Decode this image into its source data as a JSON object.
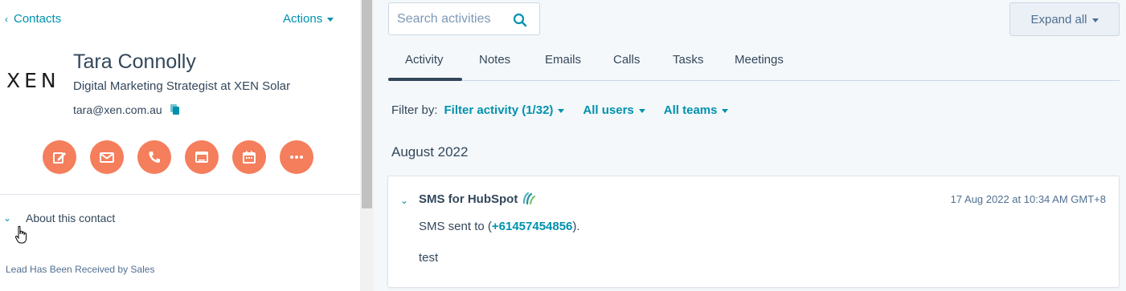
{
  "left_panel": {
    "back_label": "Contacts",
    "actions_label": "Actions",
    "logo_text": "XEN",
    "contact_name": "Tara Connolly",
    "contact_title": "Digital Marketing Strategist at XEN Solar",
    "contact_email": "tara@xen.com.au",
    "action_buttons": [
      {
        "icon": "note-icon"
      },
      {
        "icon": "email-icon"
      },
      {
        "icon": "phone-icon"
      },
      {
        "icon": "task-icon"
      },
      {
        "icon": "calendar-icon"
      },
      {
        "icon": "more-icon"
      }
    ],
    "about_label": "About this contact",
    "lead_status": "Lead Has Been Received by Sales"
  },
  "right_panel": {
    "search_placeholder": "Search activities",
    "expand_all_label": "Expand all",
    "tabs": [
      {
        "label": "Activity",
        "active": true
      },
      {
        "label": "Notes"
      },
      {
        "label": "Emails"
      },
      {
        "label": "Calls"
      },
      {
        "label": "Tasks"
      },
      {
        "label": "Meetings"
      }
    ],
    "filter_by_label": "Filter by:",
    "filters": {
      "activity": "Filter activity (1/32)",
      "users": "All users",
      "teams": "All teams"
    },
    "month_header": "August 2022",
    "activity_card": {
      "title": "SMS for HubSpot",
      "timestamp": "17 Aug 2022 at 10:34 AM GMT+8",
      "body_prefix": "SMS sent to (",
      "phone": "+61457454856",
      "body_suffix": ").",
      "message": "test"
    }
  },
  "colors": {
    "accent": "#0091ae",
    "action_button": "#f57e5c",
    "text": "#33475b",
    "right_bg": "#f5f8fa"
  }
}
